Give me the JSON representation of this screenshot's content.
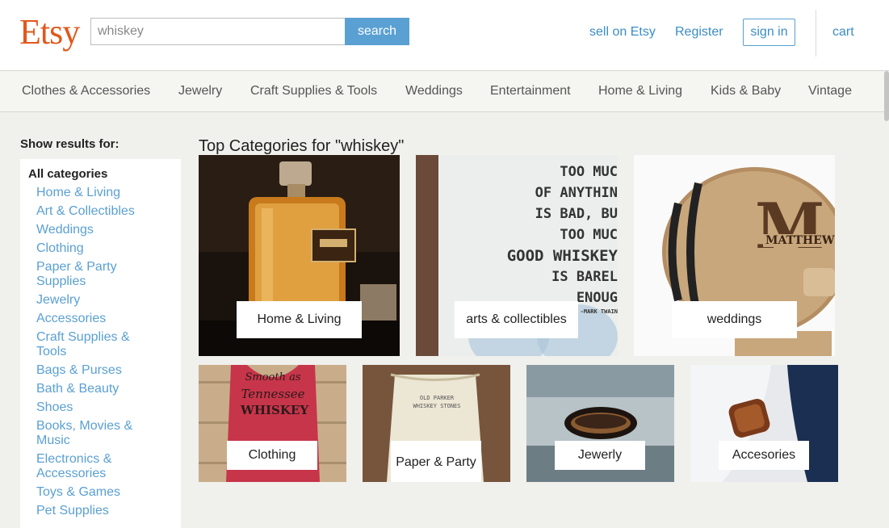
{
  "header": {
    "logo": "Etsy",
    "search_value": "whiskey",
    "search_button": "search",
    "links": {
      "sell": "sell on Etsy",
      "register": "Register",
      "signin": "sign in",
      "cart": "cart"
    }
  },
  "nav": {
    "categories": [
      "Clothes & Accessories",
      "Jewelry",
      "Craft Supplies & Tools",
      "Weddings",
      "Entertainment",
      "Home & Living",
      "Kids & Baby",
      "Vintage"
    ]
  },
  "sidebar": {
    "title": "Show results for:",
    "all_label": "All categories",
    "items": [
      "Home & Living",
      "Art & Collectibles",
      "Weddings",
      "Clothing",
      "Paper & Party Supplies",
      "Jewelry",
      "Accessories",
      "Craft Supplies & Tools",
      "Bags & Purses",
      "Bath & Beauty",
      "Shoes",
      "Books, Movies & Music",
      "Electronics & Accessories",
      "Toys & Games",
      "Pet Supplies"
    ]
  },
  "main": {
    "title": "Top Categories for \"whiskey\"",
    "tiles": [
      {
        "label": "Home & Living"
      },
      {
        "label": "arts & collectibles",
        "print_lines": [
          "TOO MUC",
          "OF ANYTHIN",
          "IS BAD, BU",
          "TOO MUC",
          "GOOD WHISKEY",
          "IS BAREL",
          "ENOUG",
          "-MARK TWAIN"
        ]
      },
      {
        "label": "weddings",
        "engraving_letter": "M",
        "engraving_name": "MATTHEWS"
      },
      {
        "label": "Clothing",
        "shirt_lines": [
          "Smooth as",
          "Tennessee",
          "WHISKEY"
        ]
      },
      {
        "label": "Paper & Party",
        "bag_lines": [
          "OLD PARKER",
          "WHISKEY STONES"
        ]
      },
      {
        "label": "Jewerly"
      },
      {
        "label": "Accesories"
      }
    ]
  },
  "colors": {
    "brand": "#e1581c",
    "link": "#5aa0d3",
    "button": "#5aa0d3"
  }
}
